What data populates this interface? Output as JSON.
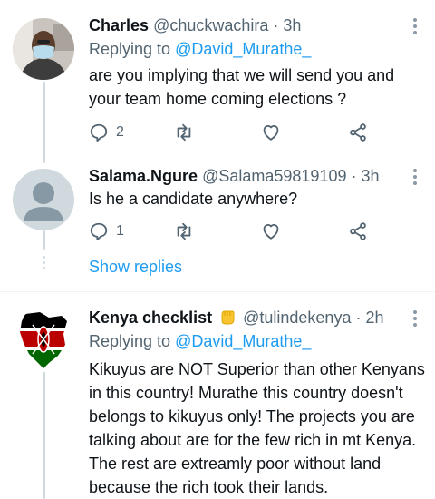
{
  "tweets": [
    {
      "name": "Charles",
      "handle": "@chuckwachira",
      "time": "· 3h",
      "replying_prefix": "Replying to",
      "replying_to": "@David_Murathe_",
      "text": "are you implying that we will send you and your team home coming elections ?",
      "actions": {
        "reply_count": "2",
        "retweet_count": "",
        "like_count": ""
      }
    },
    {
      "name": "Salama.Ngure",
      "handle": "@Salama59819109",
      "time": "· 3h",
      "text": "Is he a candidate anywhere?",
      "actions": {
        "reply_count": "1",
        "retweet_count": "",
        "like_count": ""
      }
    },
    {
      "name": "Kenya checklist",
      "name_emoji": "raised-fist-emoji",
      "handle": "@tulindekenya",
      "time": "· 2h",
      "replying_prefix": "Replying to",
      "replying_to": "@David_Murathe_",
      "text": "Kikuyus are NOT Superior than other Kenyans in this country! Murathe this country doesn't belongs to kikuyus only! The projects you are talking about are for the few rich in mt Kenya. The rest are extreamly poor without land because the rich took their lands."
    }
  ],
  "show_replies_label": "Show replies",
  "colors": {
    "accent": "#1d9bf0",
    "secondary_text": "#536471",
    "thread_line": "#cfd9de"
  }
}
